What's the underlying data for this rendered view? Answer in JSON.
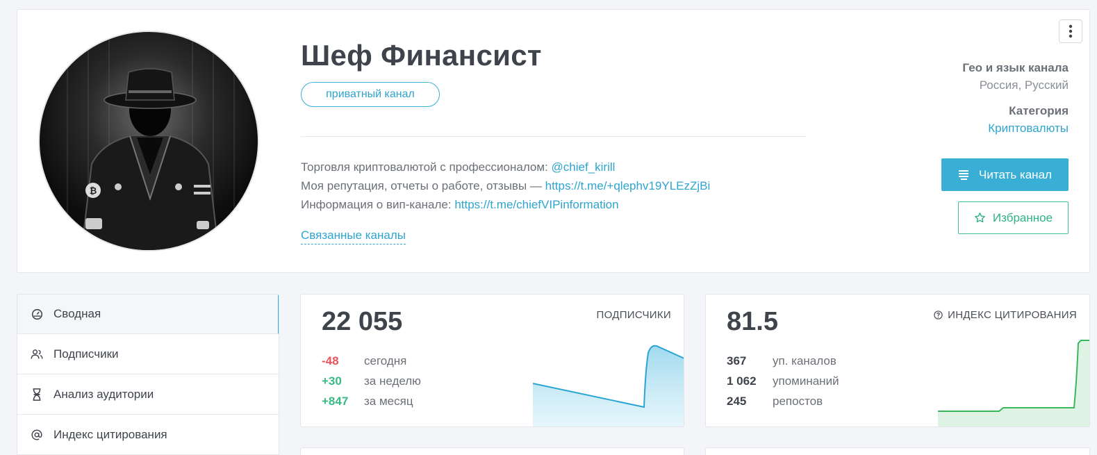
{
  "channel": {
    "title": "Шеф Финансист",
    "badge": "приватный канал",
    "description": {
      "line1_text": "Торговля криптовалютой с профессионалом: ",
      "line1_link": "@chief_kirill",
      "line2_text": "Моя репутация, отчеты о работе, отзывы — ",
      "line2_link": "https://t.me/+qlephv19YLEzZjBi",
      "line3_text": "Информация о вип-канале: ",
      "line3_link": "https://t.me/chiefVIPinformation"
    },
    "related_label": "Связанные каналы"
  },
  "meta": {
    "geo_label": "Гео и язык канала",
    "geo_value": "Россия, Русский",
    "category_label": "Категория",
    "category_value": "Криптовалюты"
  },
  "actions": {
    "read_label": "Читать канал",
    "favorite_label": "Избранное"
  },
  "sidebar": {
    "items": [
      {
        "label": "Сводная",
        "icon": "dashboard-icon"
      },
      {
        "label": "Подписчики",
        "icon": "users-icon"
      },
      {
        "label": "Анализ аудитории",
        "icon": "dna-icon"
      },
      {
        "label": "Индекс цитирования",
        "icon": "at-icon"
      }
    ]
  },
  "subscribers": {
    "total": "22 055",
    "title": "ПОДПИСЧИКИ",
    "rows": [
      {
        "value": "-48",
        "label": "сегодня"
      },
      {
        "value": "+30",
        "label": "за неделю"
      },
      {
        "value": "+847",
        "label": "за месяц"
      }
    ]
  },
  "citation": {
    "index": "81.5",
    "title": "ИНДЕКС ЦИТИРОВАНИЯ",
    "rows": [
      {
        "value": "367",
        "label": "уп. каналов"
      },
      {
        "value": "1 062",
        "label": "упоминаний"
      },
      {
        "value": "245",
        "label": "репостов"
      }
    ]
  },
  "colors": {
    "accent": "#3aafd6",
    "positive": "#39b984",
    "negative": "#e9545b",
    "favorite": "#2fb383"
  }
}
